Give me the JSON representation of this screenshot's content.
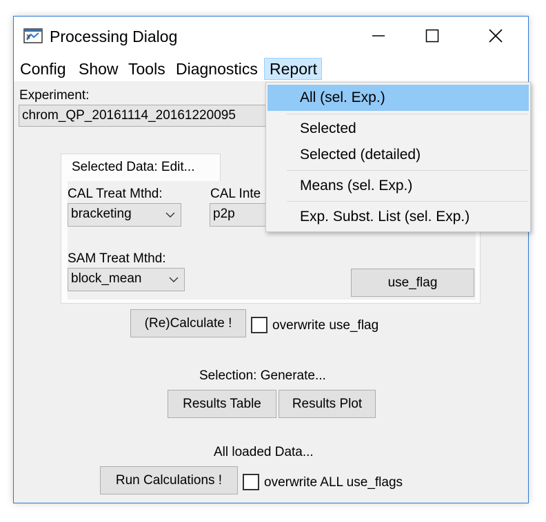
{
  "window": {
    "title": "Processing Dialog",
    "icon": "app-window-icon"
  },
  "menubar": {
    "items": [
      "Config",
      "Show",
      "Tools",
      "Diagnostics",
      "Report"
    ],
    "active": "Report"
  },
  "report_menu": {
    "items": [
      "All (sel. Exp.)",
      "Selected",
      "Selected (detailed)",
      "Means (sel. Exp.)",
      "Exp. Subst. List (sel. Exp.)"
    ],
    "highlighted": "All (sel. Exp.)"
  },
  "experiment": {
    "label": "Experiment:",
    "value": "chrom_QP_20161114_20161220095"
  },
  "selected_data": {
    "tab_label": "Selected Data: Edit...",
    "cal_treat_label": "CAL Treat Mthd:",
    "cal_treat_value": "bracketing",
    "cal_interp_label": "CAL Inte",
    "cal_interp_value": "p2p",
    "sam_treat_label": "SAM Treat Mthd:",
    "sam_treat_value": "block_mean",
    "use_flag_button": "use_flag"
  },
  "recalc": {
    "button": "(Re)Calculate !",
    "checkbox_label": "overwrite use_flag",
    "checked": false
  },
  "selection": {
    "heading": "Selection: Generate...",
    "results_table": "Results Table",
    "results_plot": "Results Plot"
  },
  "all_data": {
    "heading": "All loaded Data...",
    "run_button": "Run Calculations !",
    "checkbox_label": "overwrite ALL use_flags",
    "checked": false
  },
  "colors": {
    "border_accent": "#2b78d4",
    "menu_hover": "#cce8ff",
    "menu_highlight": "#91c9f7",
    "dialog_bg": "#f0f0f0"
  }
}
